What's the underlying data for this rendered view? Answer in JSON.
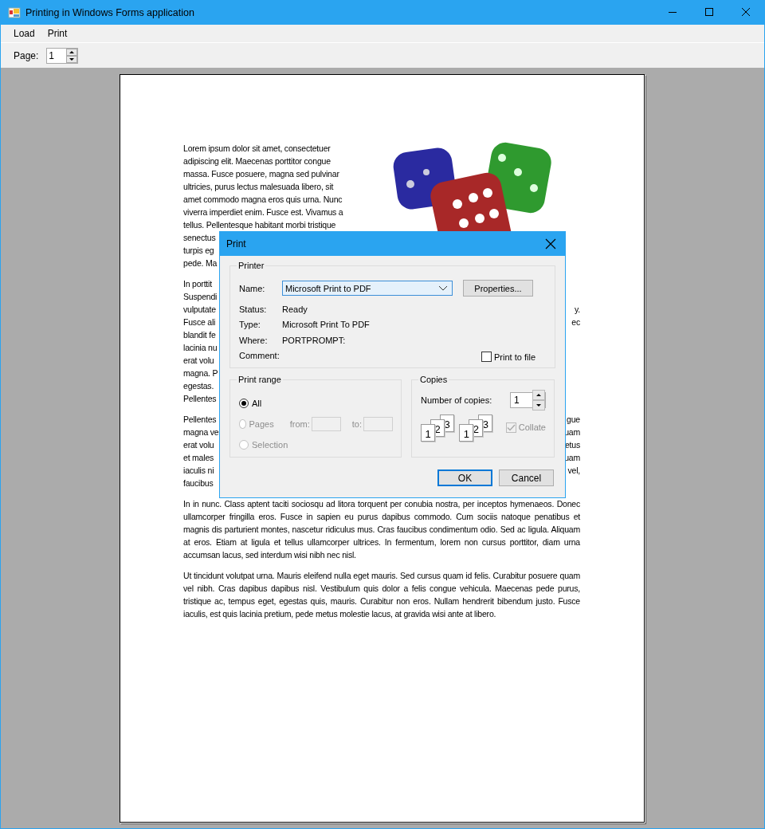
{
  "window": {
    "title": "Printing in Windows Forms application"
  },
  "menu": [
    {
      "label": "Load"
    },
    {
      "label": "Print"
    }
  ],
  "toolbar": {
    "page_label": "Page:",
    "page_value": "1"
  },
  "document": {
    "paragraphs": [
      {
        "lines": [
          {
            "left": "Lorem ipsum dolor sit amet, consectetuer"
          },
          {
            "left": "adipiscing elit. Maecenas porttitor congue"
          },
          {
            "left": "massa. Fusce posuere, magna sed pulvinar"
          },
          {
            "left": "ultricies, purus lectus malesuada libero, sit"
          },
          {
            "left": "amet commodo magna eros quis urna. Nunc"
          },
          {
            "left": "viverra imperdiet enim. Fusce est. Vivamus a"
          },
          {
            "left": "tellus. Pellentesque habitant morbi tristique"
          },
          {
            "left": "senectus"
          },
          {
            "left": "turpis eg"
          },
          {
            "left": "pede. Ma"
          }
        ]
      },
      {
        "lines": [
          {
            "left": "In porttit"
          },
          {
            "left": "Suspendi"
          },
          {
            "left": "vulputate",
            "right": "y."
          },
          {
            "left": "Fusce ali",
            "right": "ec"
          },
          {
            "left": "blandit fe"
          },
          {
            "left": "lacinia nu"
          },
          {
            "left": "erat volu"
          },
          {
            "left": "magna. P"
          },
          {
            "left": "egestas."
          },
          {
            "left": "Pellentes"
          }
        ]
      },
      {
        "lines": [
          {
            "left": "Pellentes",
            "right": "gue"
          },
          {
            "left": "magna ve",
            "right": "uam"
          },
          {
            "left": "erat volu",
            "right": "etus"
          },
          {
            "left": "et males",
            "right": "uam"
          },
          {
            "left": "iaculis ni",
            "right": "vel,"
          },
          {
            "left": "faucibus"
          }
        ]
      }
    ],
    "full_paragraphs": [
      "In in nunc. Class aptent taciti sociosqu ad litora torquent per conubia nostra, per inceptos hymenaeos. Donec ullamcorper fringilla eros. Fusce in sapien eu purus dapibus commodo. Cum sociis natoque penatibus et magnis dis parturient montes, nascetur ridiculus mus. Cras faucibus condimentum odio. Sed ac ligula. Aliquam at eros. Etiam at ligula et tellus ullamcorper ultrices. In fermentum, lorem non cursus porttitor, diam urna accumsan lacus, sed interdum wisi nibh nec nisl.",
      "Ut tincidunt volutpat urna. Mauris eleifend nulla eget mauris. Sed cursus quam id felis. Curabitur posuere quam vel nibh. Cras dapibus dapibus nisl. Vestibulum quis dolor a felis congue vehicula. Maecenas pede purus, tristique ac, tempus eget, egestas quis, mauris. Curabitur non eros. Nullam hendrerit bibendum justo. Fusce iaculis, est quis lacinia pretium, pede metus molestie lacus, at gravida wisi ante at libero."
    ]
  },
  "dialog": {
    "title": "Print",
    "printer": {
      "legend": "Printer",
      "name_label": "Name:",
      "name_value": "Microsoft Print to PDF",
      "properties_button": "Properties...",
      "info": [
        {
          "label": "Status:",
          "value": "Ready"
        },
        {
          "label": "Type:",
          "value": "Microsoft Print To PDF"
        },
        {
          "label": "Where:",
          "value": "PORTPROMPT:"
        },
        {
          "label": "Comment:"
        }
      ],
      "print_to_file": {
        "label": "Print to file",
        "checked": false
      }
    },
    "print_range": {
      "legend": "Print range",
      "options": [
        {
          "label": "All",
          "selected": true,
          "disabled": false
        },
        {
          "label": "Pages",
          "selected": false,
          "disabled": true
        },
        {
          "label": "Selection",
          "selected": false,
          "disabled": true
        }
      ],
      "from_label": "from:",
      "to_label": "to:"
    },
    "copies": {
      "legend": "Copies",
      "count_label": "Number of copies:",
      "count_value": "1",
      "stacks": [
        [
          "1",
          "2",
          "3"
        ],
        [
          "1",
          "2",
          "3"
        ]
      ],
      "collate": {
        "label": "Collate",
        "checked": true,
        "disabled": true
      }
    },
    "buttons": [
      {
        "label": "OK",
        "default": true
      },
      {
        "label": "Cancel",
        "default": false
      }
    ]
  }
}
